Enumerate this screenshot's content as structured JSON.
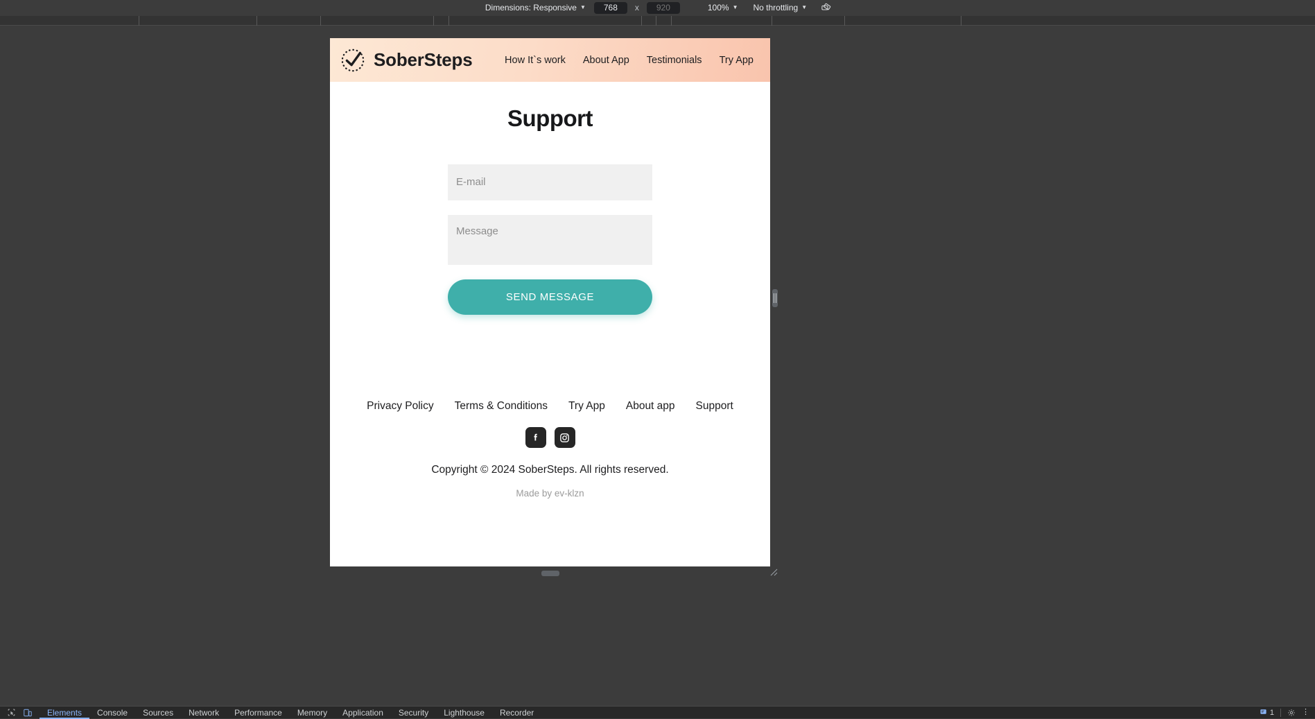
{
  "device_toolbar": {
    "dimensions_label": "Dimensions: Responsive",
    "width_value": "768",
    "height_placeholder": "920",
    "x_separator": "x",
    "zoom_label": "100%",
    "throttling_label": "No throttling",
    "rotate_icon": "rotate-device-icon"
  },
  "site": {
    "header": {
      "brand_name": "SoberSteps",
      "logo_icon": "checkmark-in-dotted-circle-icon",
      "nav": [
        {
          "label": "How It`s work"
        },
        {
          "label": "About App"
        },
        {
          "label": "Testimonials"
        },
        {
          "label": "Try App"
        }
      ]
    },
    "main": {
      "title": "Support",
      "form": {
        "email_placeholder": "E-mail",
        "email_value": "",
        "message_placeholder": "Message",
        "message_value": "",
        "submit_label": "SEND MESSAGE"
      }
    },
    "footer": {
      "links": [
        {
          "label": "Privacy Policy"
        },
        {
          "label": "Terms & Conditions"
        },
        {
          "label": "Try App"
        },
        {
          "label": "About app"
        },
        {
          "label": "Support"
        }
      ],
      "social": [
        {
          "name": "facebook-icon"
        },
        {
          "name": "instagram-icon"
        }
      ],
      "copyright": "Copyright © 2024 SoberSteps. All rights reserved.",
      "made_by": "Made by ev-klzn"
    }
  },
  "devtools": {
    "inspect_icon": "inspect-element-icon",
    "device_toggle_icon": "toggle-device-toolbar-icon",
    "tabs": [
      {
        "label": "Elements",
        "active": true
      },
      {
        "label": "Console",
        "active": false
      },
      {
        "label": "Sources",
        "active": false
      },
      {
        "label": "Network",
        "active": false
      },
      {
        "label": "Performance",
        "active": false
      },
      {
        "label": "Memory",
        "active": false
      },
      {
        "label": "Application",
        "active": false
      },
      {
        "label": "Security",
        "active": false
      },
      {
        "label": "Lighthouse",
        "active": false
      },
      {
        "label": "Recorder",
        "active": false
      }
    ],
    "message_count": "1",
    "message_icon": "console-message-icon",
    "settings_icon": "gear-icon",
    "more_icon": "kebab-menu-icon"
  },
  "colors": {
    "accent_teal": "#3FAFAA",
    "header_gradient_start": "#FDE8D5",
    "header_gradient_end": "#F9C4AD",
    "field_bg": "#F0F0F0",
    "devtools_bg": "#3C3C3C",
    "tab_active": "#8AB4F8"
  }
}
